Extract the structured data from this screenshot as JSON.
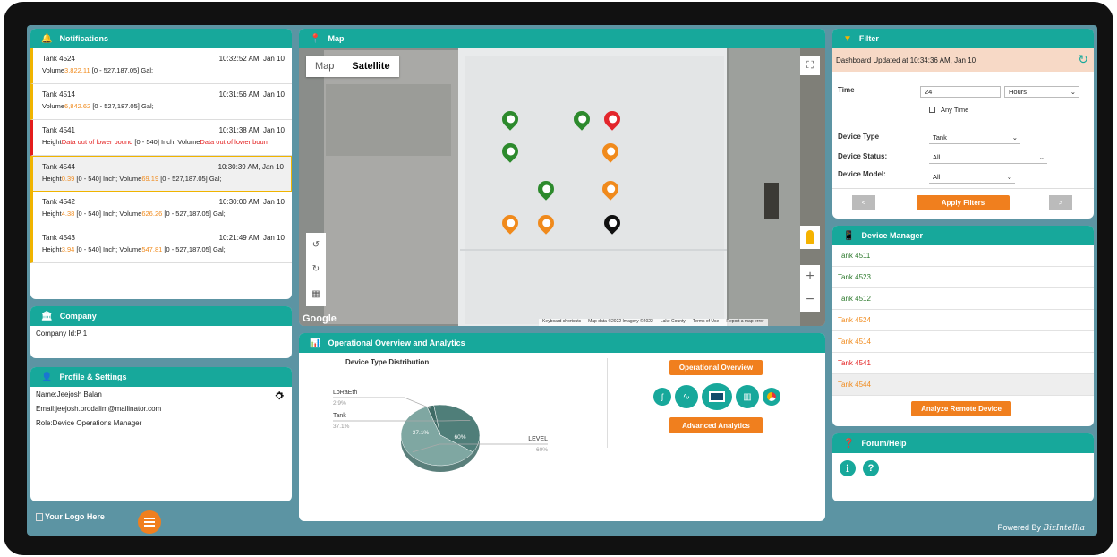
{
  "notifications": {
    "title": "Notifications",
    "items": [
      {
        "tank": "Tank 4524",
        "time": "10:32:52 AM, Jan 10",
        "d1": "Volume",
        "d2": "3,822.11",
        "d3": " [0 - 527,187.05] Gal;",
        "d4": "",
        "d5": "",
        "d6": ""
      },
      {
        "tank": "Tank 4514",
        "time": "10:31:56 AM, Jan 10",
        "d1": "Volume",
        "d2": "6,842.62",
        "d3": " [0 - 527,187.05] Gal;",
        "d4": "",
        "d5": "",
        "d6": ""
      },
      {
        "tank": "Tank 4541",
        "time": "10:31:38 AM, Jan 10",
        "d1": "Height",
        "d2": "Data out of lower bound",
        "d3": " [0 - 540] Inch; Volume",
        "d4": "Data out of lower boun",
        "d5": "",
        "d6": ""
      },
      {
        "tank": "Tank 4544",
        "time": "10:30:39 AM, Jan 10",
        "d1": "Height",
        "d2": "0.39",
        "d3": " [0 - 540] Inch; Volume",
        "d4": "69.19",
        "d5": " [0 - 527,187.05] Gal;",
        "d6": ""
      },
      {
        "tank": "Tank 4542",
        "time": "10:30:00 AM, Jan 10",
        "d1": "Height",
        "d2": "4.38",
        "d3": " [0 - 540] Inch; Volume",
        "d4": "626.26",
        "d5": " [0 - 527,187.05] Gal;",
        "d6": ""
      },
      {
        "tank": "Tank 4543",
        "time": "10:21:49 AM, Jan 10",
        "d1": "Height",
        "d2": "3.94",
        "d3": " [0 - 540] Inch; Volume",
        "d4": "547.81",
        "d5": " [0 - 527,187.05] Gal;",
        "d6": ""
      }
    ]
  },
  "company": {
    "title": "Company",
    "id_line": "Company Id:P 1"
  },
  "profile": {
    "title": "Profile & Settings",
    "name": "Name:Jeejosh Balan",
    "email": "Email:jeejosh.prodalim@mailinator.com",
    "role": "Role:Device Operations Manager"
  },
  "logo_text": "Your Logo Here",
  "map": {
    "title": "Map",
    "tab_map": "Map",
    "tab_satellite": "Satellite",
    "google": "Google",
    "attrib": [
      "Keyboard shortcuts",
      "Map data ©2022 Imagery ©2022",
      "Lake County",
      "Terms of Use",
      "Report a map error"
    ]
  },
  "overview": {
    "title": "Operational Overview and Analytics",
    "chart_title": "Device Type Distribution",
    "btn_overview": "Operational Overview",
    "btn_analytics": "Advanced Analytics"
  },
  "chart_data": {
    "type": "pie",
    "title": "Device Type Distribution",
    "categories": [
      "LoRaEth",
      "Tank",
      "LEVEL"
    ],
    "values": [
      2.9,
      37.1,
      60
    ],
    "labels": [
      "2.9%",
      "37.1%",
      "60%"
    ],
    "inner_labels": [
      "37.1%",
      "60%"
    ],
    "colors": [
      "#3f6b66",
      "#4f7e79",
      "#7fa7a2"
    ]
  },
  "filter": {
    "title": "Filter",
    "updated": "Dashboard Updated at 10:34:36 AM, Jan 10",
    "time_label": "Time",
    "time_value": "24",
    "time_unit": "Hours",
    "any_time": "Any Time",
    "type_label": "Device Type",
    "type_value": "Tank",
    "status_label": "Device Status:",
    "status_value": "All",
    "model_label": "Device Model:",
    "model_value": "All",
    "apply": "Apply Filters",
    "prev": "<",
    "next": ">"
  },
  "device_manager": {
    "title": "Device Manager",
    "items": [
      {
        "name": "Tank 4511",
        "color": "#2d7a2d"
      },
      {
        "name": "Tank 4523",
        "color": "#2d7a2d"
      },
      {
        "name": "Tank 4512",
        "color": "#2d7a2d"
      },
      {
        "name": "Tank 4524",
        "color": "#f08a1c"
      },
      {
        "name": "Tank 4514",
        "color": "#f08a1c"
      },
      {
        "name": "Tank 4541",
        "color": "#e31d1d"
      },
      {
        "name": "Tank 4544",
        "color": "#f08a1c"
      }
    ],
    "analyze": "Analyze Remote Device"
  },
  "forum": {
    "title": "Forum/Help"
  },
  "footer": {
    "powered": "Powered By ",
    "brand": "BizIntellia"
  },
  "colors": {
    "teal": "#17a89b",
    "orange": "#f07f1e",
    "bg": "#5c94a3"
  }
}
